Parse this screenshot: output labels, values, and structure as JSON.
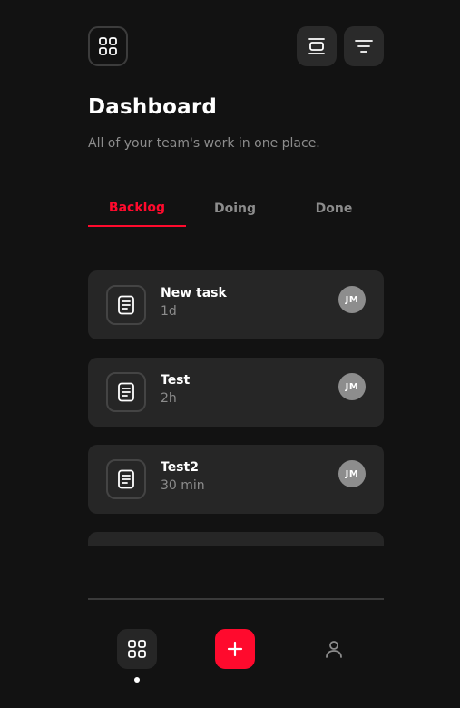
{
  "header": {
    "title": "Dashboard",
    "subtitle": "All of your team's work in one place.",
    "left_icon": "grid-icon",
    "right_icons": [
      "align-center-icon",
      "filter-icon"
    ]
  },
  "tabs": [
    {
      "label": "Backlog",
      "active": true
    },
    {
      "label": "Doing",
      "active": false
    },
    {
      "label": "Done",
      "active": false
    }
  ],
  "tasks": [
    {
      "title": "New task",
      "meta": "1d",
      "assignee": "JM",
      "icon": "document-icon"
    },
    {
      "title": "Test",
      "meta": "2h",
      "assignee": "JM",
      "icon": "document-icon"
    },
    {
      "title": "Test2",
      "meta": "30 min",
      "assignee": "JM",
      "icon": "document-icon"
    }
  ],
  "bottom_nav": {
    "items": [
      "grid-icon",
      "plus-icon",
      "user-icon"
    ],
    "active_index": 0
  },
  "colors": {
    "background": "#121212",
    "card": "#262626",
    "accent": "#ff0a2d",
    "muted_text": "#8c8c8c",
    "avatar": "#8d8d8d"
  }
}
